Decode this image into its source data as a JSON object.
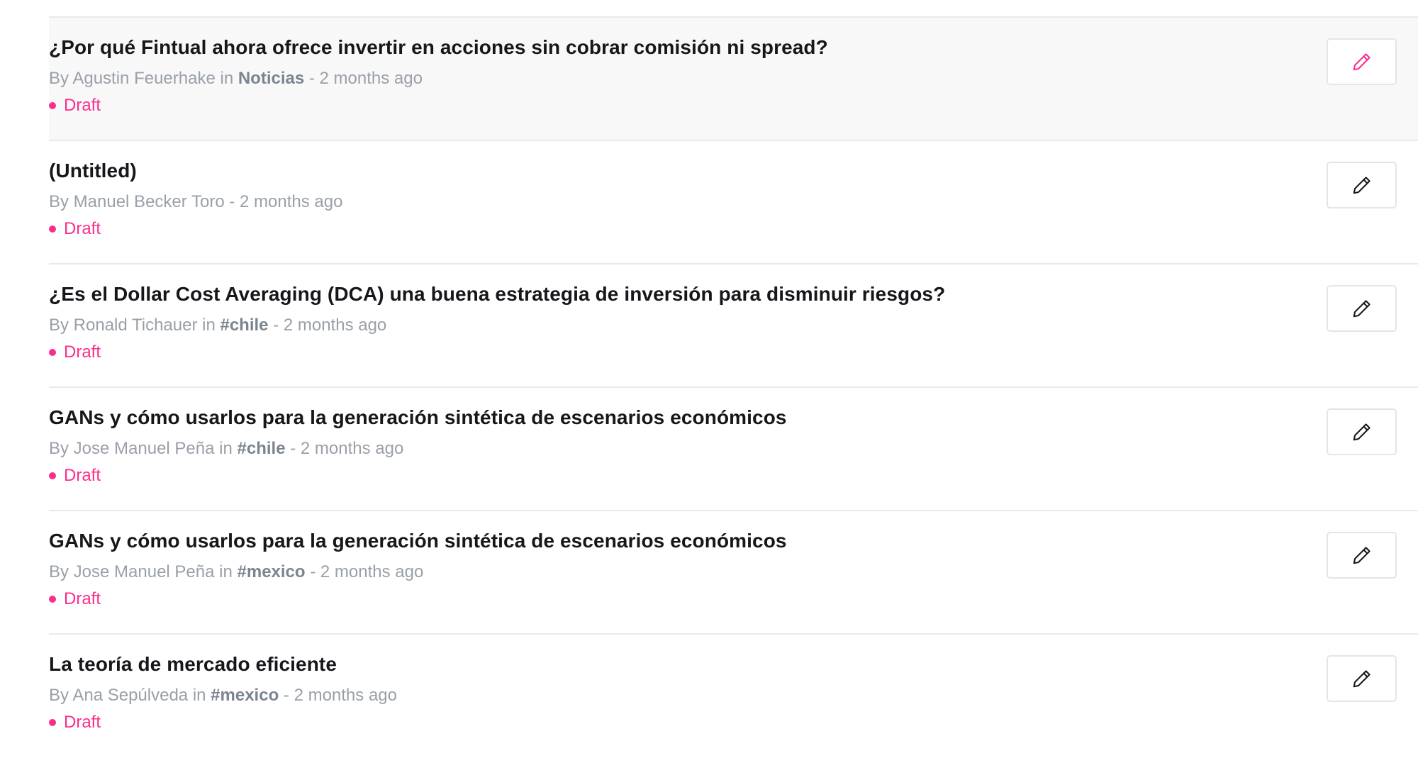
{
  "colors": {
    "accent": "#fb2d8d",
    "title": "#15171a",
    "meta": "#9aa0a8",
    "icon_default": "#15171a",
    "row_highlight": "#f8f8f9"
  },
  "posts": [
    {
      "title": "¿Por qué Fintual ahora ofrece invertir en acciones sin cobrar comisión ni spread?",
      "by": "By Agustin Feuerhake",
      "in": " in ",
      "tag": "Noticias",
      "time": " - 2 months ago",
      "status": "Draft",
      "edit_icon": "pencil-icon",
      "highlighted": true
    },
    {
      "title": "(Untitled)",
      "by": "By Manuel Becker Toro",
      "in": "",
      "tag": "",
      "time": " - 2 months ago",
      "status": "Draft",
      "edit_icon": "pencil-icon",
      "highlighted": false
    },
    {
      "title": "¿Es el Dollar Cost Averaging (DCA) una buena estrategia de inversión para disminuir riesgos?",
      "by": "By Ronald Tichauer",
      "in": " in ",
      "tag": "#chile",
      "time": " - 2 months ago",
      "status": "Draft",
      "edit_icon": "pencil-icon",
      "highlighted": false
    },
    {
      "title": "GANs y cómo usarlos para la generación sintética de escenarios económicos",
      "by": "By Jose Manuel Peña",
      "in": " in ",
      "tag": "#chile",
      "time": " - 2 months ago",
      "status": "Draft",
      "edit_icon": "pencil-icon",
      "highlighted": false
    },
    {
      "title": "GANs y cómo usarlos para la generación sintética de escenarios económicos",
      "by": "By Jose Manuel Peña",
      "in": " in ",
      "tag": "#mexico",
      "time": " - 2 months ago",
      "status": "Draft",
      "edit_icon": "pencil-icon",
      "highlighted": false
    },
    {
      "title": "La teoría de mercado eficiente",
      "by": "By Ana Sepúlveda",
      "in": " in ",
      "tag": "#mexico",
      "time": " - 2 months ago",
      "status": "Draft",
      "edit_icon": "pencil-icon",
      "highlighted": false
    }
  ]
}
